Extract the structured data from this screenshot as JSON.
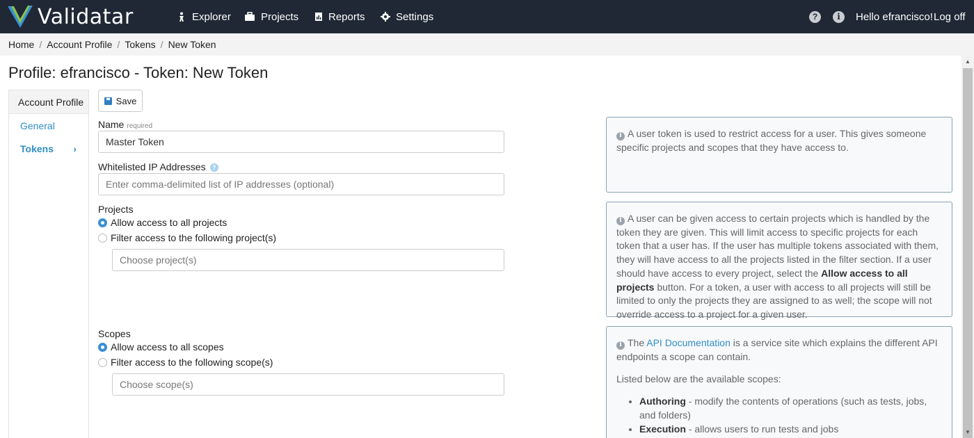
{
  "nav": {
    "brand": "Validatar",
    "items": [
      {
        "label": "Explorer",
        "icon": "explorer-icon"
      },
      {
        "label": "Projects",
        "icon": "briefcase-icon"
      },
      {
        "label": "Reports",
        "icon": "report-icon"
      },
      {
        "label": "Settings",
        "icon": "gear-icon"
      }
    ],
    "help_icon": "?",
    "info_icon": "i",
    "greeting": "Hello efrancisco!",
    "logoff": "Log off"
  },
  "breadcrumb": [
    "Home",
    "Account Profile",
    "Tokens",
    "New Token"
  ],
  "page_title": "Profile: efrancisco - Token: New Token",
  "sidebar": {
    "header": "Account Profile",
    "items": [
      {
        "label": "General"
      },
      {
        "label": "Tokens",
        "chevron": "›"
      }
    ]
  },
  "form": {
    "save_label": "Save",
    "name_label": "Name",
    "name_required": "required",
    "name_value": "Master Token",
    "ip_label": "Whitelisted IP Addresses",
    "ip_help": "?",
    "ip_placeholder": "Enter comma-delimited list of IP addresses (optional)",
    "projects_label": "Projects",
    "projects_all": "Allow access to all projects",
    "projects_filter": "Filter access to the following project(s)",
    "projects_placeholder": "Choose project(s)",
    "scopes_label": "Scopes",
    "scopes_all": "Allow access to all scopes",
    "scopes_filter": "Filter access to the following scope(s)",
    "scopes_placeholder": "Choose scope(s)"
  },
  "info": {
    "box1": "A user token is used to restrict access for a user. This gives someone specific projects and scopes that they have access to.",
    "box2_pre": "A user can be given access to certain projects which is handled by the token they are given. This will limit access to specific projects for each token that a user has. If the user has multiple tokens associated with them, they will have access to all the projects listed in the filter section. If a user should have access to every project, select the ",
    "box2_bold": "Allow access to all projects",
    "box2_post": " button. For a token, a user with access to all projects will still be limited to only the projects they are assigned to as well; the scope will not override access to a project for a given user.",
    "box3_pre": "The ",
    "box3_link": "API Documentation",
    "box3_post": " is a service site which explains the different API endpoints a scope can contain.",
    "box3_listed": "Listed below are the available scopes:",
    "scopes": [
      {
        "name": "Authoring",
        "desc": " - modify the contents of operations (such as tests, jobs, and folders)"
      },
      {
        "name": "Execution",
        "desc": " - allows users to run tests and jobs"
      }
    ]
  },
  "colors": {
    "nav_bg": "#1f2834",
    "link": "#2f8ec6",
    "radio_on": "#3b8fd4"
  }
}
